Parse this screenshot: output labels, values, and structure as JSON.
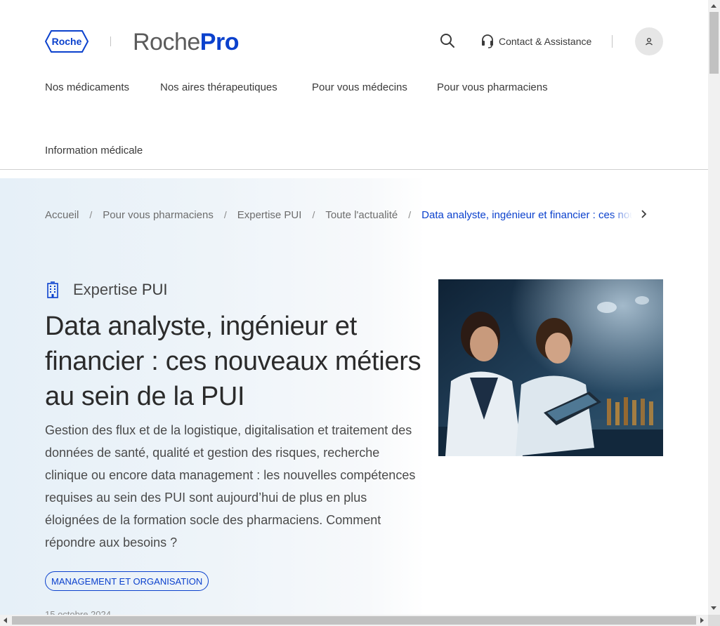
{
  "brand": {
    "roche_logo_text": "Roche",
    "product_name_part1": "Roche",
    "product_name_part2": "Pro",
    "accent_color": "#0b41cd"
  },
  "header": {
    "search_icon": "search-icon",
    "contact_label": "Contact & Assistance",
    "contact_icon": "headset-icon",
    "user_icon": "user-icon"
  },
  "nav": {
    "items": [
      {
        "label": "Nos médicaments"
      },
      {
        "label": "Nos aires thérapeutiques"
      },
      {
        "label": "Pour vous médecins"
      },
      {
        "label": "Pour vous pharmaciens"
      },
      {
        "label": "Information médicale"
      }
    ]
  },
  "breadcrumb": {
    "items": [
      {
        "label": "Accueil"
      },
      {
        "label": "Pour vous pharmaciens"
      },
      {
        "label": "Expertise PUI"
      },
      {
        "label": "Toute l'actualité"
      }
    ],
    "current": "Data analyste, ingénieur et financier : ces nouveaux métiers au sein de la PUI",
    "separator": "/"
  },
  "article": {
    "category_prefix": "Expertise",
    "category_suffix": "PUI",
    "category_icon": "hospital-building-icon",
    "title": "Data analyste, ingénieur et financier : ces nouveaux métiers au sein de la PUI",
    "lead": "Gestion des flux et de la logistique, digitalisation et traitement des données de santé, qualité et gestion des risques, recherche clinique ou encore data management : les nouvelles compétences requises au sein des PUI sont aujourd’hui de plus en plus éloignées de la formation socle des pharmaciens. Comment répondre aux besoins ?",
    "tag": "MANAGEMENT ET ORGANISATION",
    "date": "15 octobre 2024",
    "image_alt": "laboratory-scientists-photo"
  }
}
